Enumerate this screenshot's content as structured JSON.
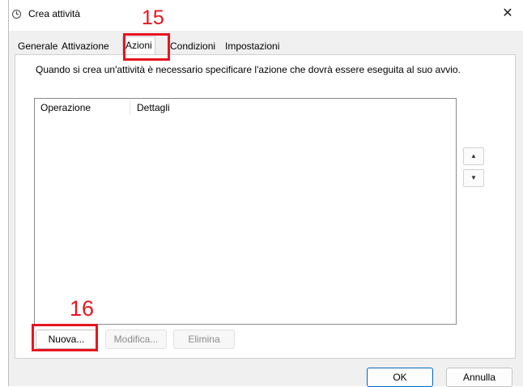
{
  "window": {
    "title": "Crea attività",
    "close_glyph": "✕"
  },
  "tabs": [
    {
      "label": "Generale"
    },
    {
      "label": "Attivazione"
    },
    {
      "label": "Azioni",
      "selected": true
    },
    {
      "label": "Condizioni"
    },
    {
      "label": "Impostazioni"
    }
  ],
  "actions_page": {
    "description": "Quando si crea un'attività è necessario specificare l'azione che dovrà essere eseguita al suo avvio.",
    "columns": [
      "Operazione",
      "Dettagli"
    ],
    "rows": [],
    "move_up_glyph": "▲",
    "move_down_glyph": "▼",
    "new_label": "Nuova...",
    "edit_label": "Modifica...",
    "delete_label": "Elimina"
  },
  "footer": {
    "ok_label": "OK",
    "cancel_label": "Annulla"
  },
  "annotations": {
    "tab_marker": "15",
    "new_button_marker": "16",
    "color": "#e8141f"
  },
  "icons": {
    "title": "clock-icon",
    "close": "close-icon",
    "up": "arrow-up-icon",
    "down": "arrow-down-icon"
  }
}
